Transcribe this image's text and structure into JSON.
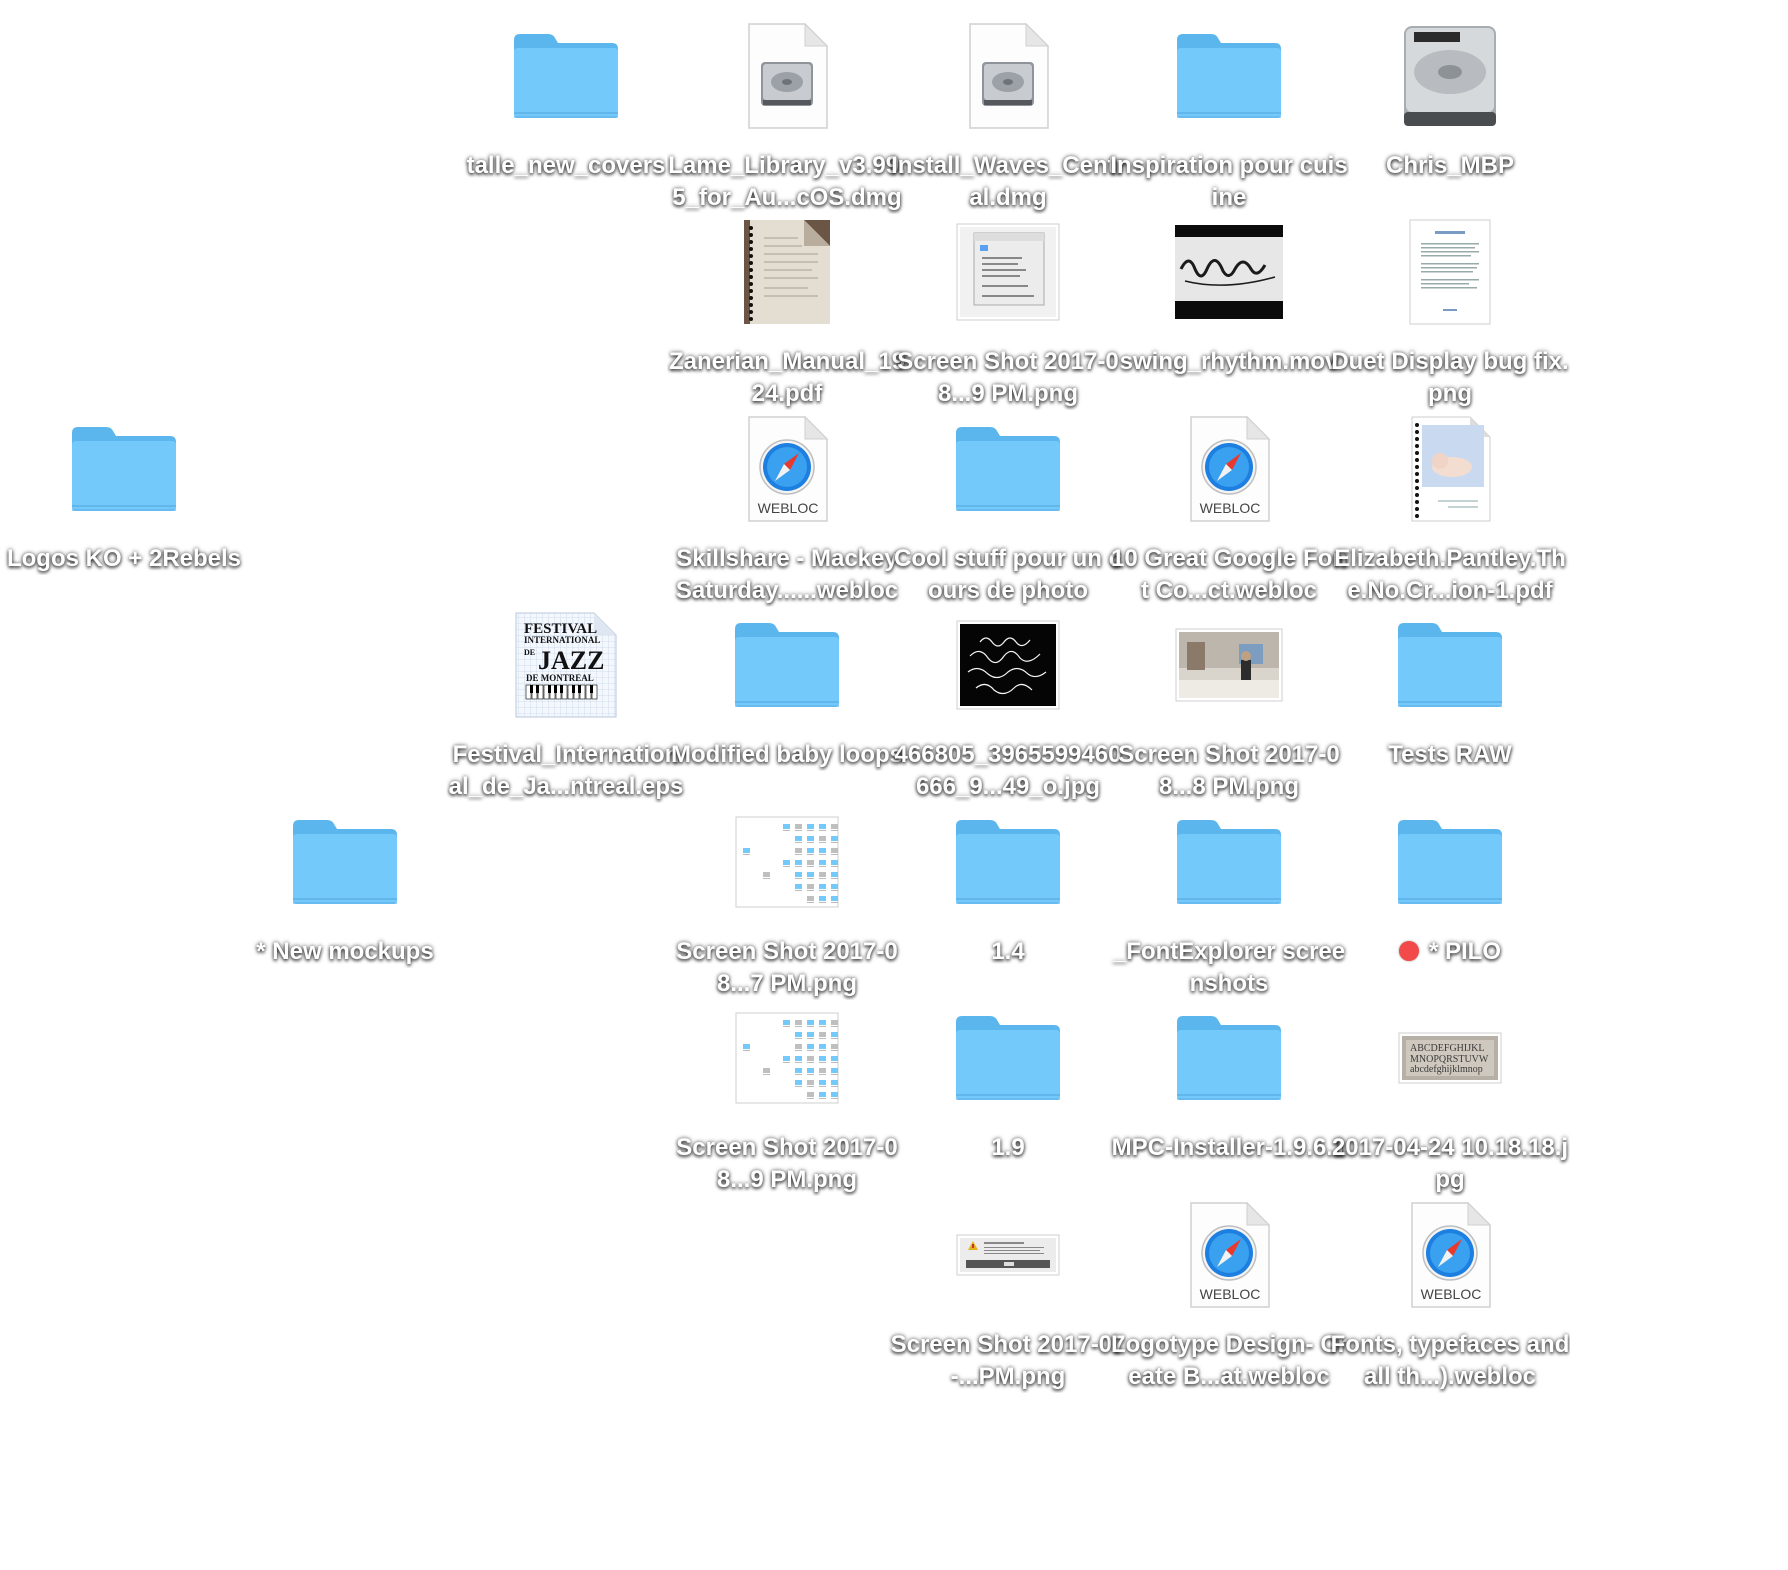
{
  "desktop": {
    "items": [
      {
        "id": "talle",
        "type": "folder",
        "label": "talle_new_covers"
      },
      {
        "id": "lame",
        "type": "dmg",
        "label": "Lame_Library_v3.99.5_for_Au...cOS.dmg"
      },
      {
        "id": "waves",
        "type": "dmg",
        "label": "Install_Waves_Central.dmg"
      },
      {
        "id": "inspiration",
        "type": "folder",
        "label": "Inspiration pour cuisine"
      },
      {
        "id": "chris",
        "type": "disk",
        "label": "Chris_MBP"
      },
      {
        "id": "zanerian",
        "type": "pdf-book",
        "label": "Zanerian_Manual_1924.pdf"
      },
      {
        "id": "shot1",
        "type": "screenshot-prefs",
        "label": "Screen Shot 2017-08...9 PM.png"
      },
      {
        "id": "swing",
        "type": "movie",
        "label": "swing_rhythm.mov"
      },
      {
        "id": "duet",
        "type": "doc-page",
        "label": "Duet Display bug fix.png"
      },
      {
        "id": "logos",
        "type": "folder",
        "label": "Logos KO + 2Rebels"
      },
      {
        "id": "skillshare",
        "type": "webloc",
        "label": "Skillshare - Mackey Saturday......webloc",
        "badge": "WEBLOC"
      },
      {
        "id": "coolstuff",
        "type": "folder",
        "label": "Cool stuff pour un cours de photo"
      },
      {
        "id": "google",
        "type": "webloc",
        "label": "10 Great Google Font Co...ct.webloc",
        "badge": "WEBLOC"
      },
      {
        "id": "pantley",
        "type": "pdf-baby",
        "label": "Elizabeth.Pantley.The.No.Cr...ion-1.pdf"
      },
      {
        "id": "jazz",
        "type": "eps",
        "label": "Festival_International_de_Ja...ntreal.eps",
        "art_lines": [
          "FESTIVAL",
          "INTERNATIONAL",
          "DE",
          "JAZZ",
          "DE MONTREAL"
        ]
      },
      {
        "id": "baby",
        "type": "folder",
        "label": "Modified baby loops"
      },
      {
        "id": "jpg466",
        "type": "calligraphy",
        "label": "466805_3965599460666_9...49_o.jpg"
      },
      {
        "id": "shot2",
        "type": "photo",
        "label": "Screen Shot 2017-08...8 PM.png"
      },
      {
        "id": "raw",
        "type": "folder",
        "label": "Tests RAW"
      },
      {
        "id": "mockups",
        "type": "folder",
        "label": "* New mockups"
      },
      {
        "id": "shot3",
        "type": "screenshot-desktop",
        "label": "Screen Shot 2017-08...7 PM.png"
      },
      {
        "id": "f14",
        "type": "folder",
        "label": "1.4"
      },
      {
        "id": "fontexp",
        "type": "folder",
        "label": "_FontExplorer screenshots"
      },
      {
        "id": "pilo",
        "type": "folder",
        "label": "* PILO",
        "tag_color": "#f24a4a"
      },
      {
        "id": "shot4",
        "type": "screenshot-desktop",
        "label": "Screen Shot 2017-08...9 PM.png"
      },
      {
        "id": "f19",
        "type": "folder",
        "label": "1.9"
      },
      {
        "id": "mpc",
        "type": "folder",
        "label": "MPC-Installer-1.9.6.1"
      },
      {
        "id": "jpg2017",
        "type": "blackletter",
        "label": "2017-04-24 10.18.18.jpg"
      },
      {
        "id": "shot5",
        "type": "screenshot-dialog",
        "label": "Screen Shot 2017-07-...PM.png"
      },
      {
        "id": "logotype",
        "type": "webloc",
        "label": "Logotype Design- Create B...at.webloc",
        "badge": "WEBLOC"
      },
      {
        "id": "fonts",
        "type": "webloc",
        "label": "Fonts, typefaces and all th...).webloc",
        "badge": "WEBLOC"
      }
    ]
  },
  "colors": {
    "folder_back": "#5cb6ee",
    "folder_front": "#74c9fb",
    "tag_red": "#f24a4a",
    "safari_blue": "#1d7fe0"
  }
}
